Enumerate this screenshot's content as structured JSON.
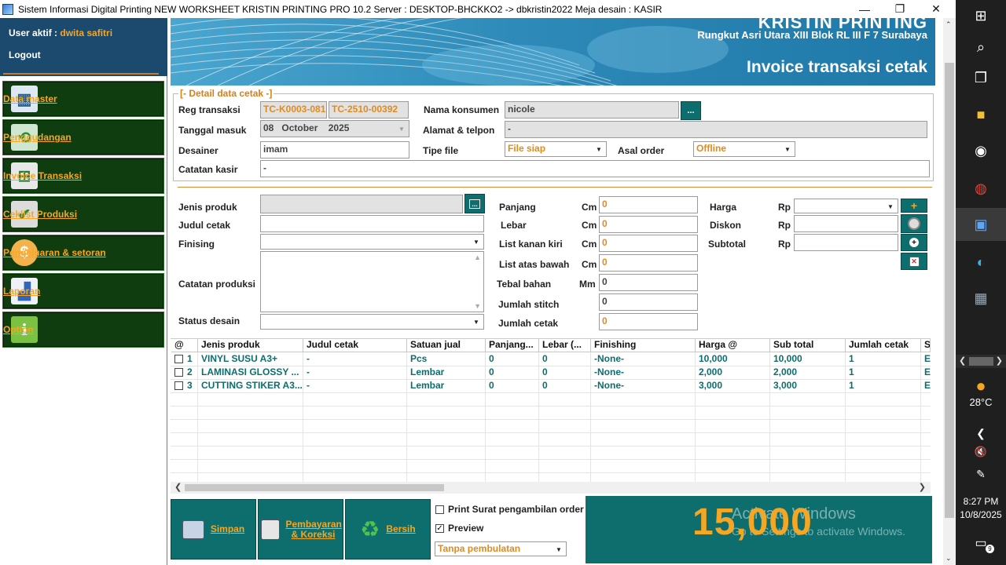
{
  "window": {
    "title": "Sistem Informasi Digital Printing NEW WORKSHEET KRISTIN PRINTING PRO 10.2 Server : DESKTOP-BHCKKO2 -> dbkristin2022 Meja desain : KASIR",
    "minimize": "—",
    "maximize": "❐",
    "close": "✕"
  },
  "sidebar": {
    "user_label": "User aktif : ",
    "user_name": "dwita safitri",
    "logout": "Logout",
    "items": [
      {
        "label": "Data master",
        "icon": "data-master-icon"
      },
      {
        "label": "Penggudangan",
        "icon": "warehouse-icon"
      },
      {
        "label": "Invoice Transaksi",
        "icon": "cart-icon"
      },
      {
        "label": "Ceklist Produksi",
        "icon": "checklist-icon"
      },
      {
        "label": "Pengeluaran & setoran",
        "icon": "money-icon"
      },
      {
        "label": "Laporan",
        "icon": "report-icon"
      },
      {
        "label": "Option",
        "icon": "info-icon"
      }
    ]
  },
  "header": {
    "brand": "KRISTIN PRINTING",
    "address": "Rungkut Asri Utara XIII Blok RL III F  7 Surabaya",
    "title": "Invoice  transaksi cetak"
  },
  "detail": {
    "group_title": "[- Detail data cetak -]",
    "reg_label": "Reg transaksi",
    "reg_code1": "TC-K0003-081",
    "reg_code2": "TC-2510-00392",
    "nama_label": "Nama konsumen",
    "nama_value": "nicole",
    "tanggal_label": "Tanggal masuk",
    "tanggal_day": "08",
    "tanggal_month": "October",
    "tanggal_year": "2025",
    "alamat_label": "Alamat & telpon",
    "alamat_value": "-",
    "desainer_label": "Desainer",
    "desainer_value": "imam",
    "tipe_label": "Tipe file",
    "tipe_value": "File siap",
    "asal_label": "Asal order",
    "asal_value": "Offline",
    "catatan_kasir_label": "Catatan kasir",
    "catatan_kasir_value": "-",
    "browse": "..."
  },
  "product": {
    "jenis_label": "Jenis produk",
    "judul_label": "Judul cetak",
    "finising_label": "Finising",
    "catatan_label": "Catatan produksi",
    "status_label": "Status desain",
    "panjang_label": "Panjang",
    "lebar_label": "Lebar",
    "listkk_label": "List kanan kiri",
    "listab_label": "List atas bawah",
    "tebal_label": "Tebal bahan",
    "stitch_label": "Jumlah stitch",
    "jumlah_label": "Jumlah cetak",
    "unit_cm": "Cm",
    "unit_mm": "Mm",
    "panjang_value": "0",
    "lebar_value": "0",
    "listkk_value": "0",
    "listab_value": "0",
    "tebal_value": "0",
    "stitch_value": "0",
    "jumlah_value": "0",
    "harga_label": "Harga",
    "diskon_label": "Diskon",
    "subtotal_label": "Subtotal",
    "unit_rp": "Rp",
    "add": "+"
  },
  "grid": {
    "headers": [
      "@",
      "Jenis produk",
      "Judul cetak",
      "Satuan jual",
      "Panjang...",
      "Lebar (...",
      "Finishing",
      "Harga @",
      "Sub total",
      "Jumlah cetak",
      "S"
    ],
    "rows": [
      [
        "1",
        "VINYL SUSU A3+",
        "-",
        "Pcs",
        "0",
        "0",
        "-None-",
        "10,000",
        "10,000",
        "1",
        "E"
      ],
      [
        "2",
        "LAMINASI GLOSSY ...",
        "-",
        "Lembar",
        "0",
        "0",
        "-None-",
        "2,000",
        "2,000",
        "1",
        "E"
      ],
      [
        "3",
        "CUTTING STIKER A3...",
        "-",
        "Lembar",
        "0",
        "0",
        "-None-",
        "3,000",
        "3,000",
        "1",
        "E"
      ]
    ]
  },
  "actions": {
    "simpan": "Simpan",
    "pembayaran": "Pembayaran & Koreksi",
    "bersih": "Bersih",
    "print_label": "Print Surat pengambilan order",
    "preview_label": "Preview",
    "print_checked": false,
    "preview_checked": true,
    "rounding": "Tanpa pembulatan",
    "total": "15,000",
    "watermark1": "Activate Windows",
    "watermark2": "Go to Settings to activate Windows."
  },
  "taskbar": {
    "temp": "28°C",
    "time": "8:27 PM",
    "date": "10/8/2025",
    "notif": "9"
  }
}
